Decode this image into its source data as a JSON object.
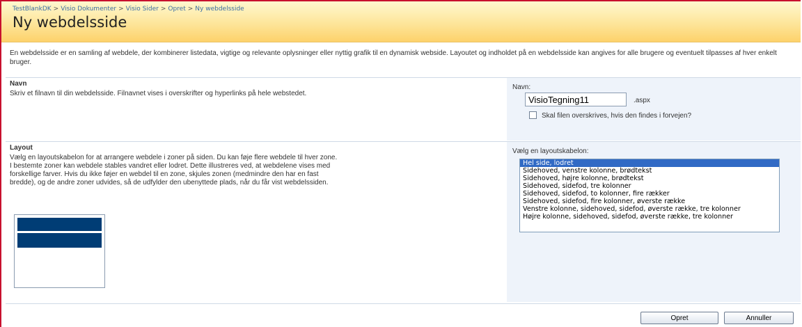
{
  "breadcrumb": [
    "TestBlankDK",
    "Visio Dokumenter",
    "Visio Sider",
    "Opret",
    "Ny webdelsside"
  ],
  "breadcrumb_separator": ">",
  "page_title": "Ny webdelsside",
  "intro": "En webdelsside er en samling af webdele, der kombinerer listedata, vigtige og relevante oplysninger eller nyttig grafik til en dynamisk webside. Layoutet og indholdet på en webdelsside kan angives for alle brugere og eventuelt tilpasses af hver enkelt bruger.",
  "name_section": {
    "title": "Navn",
    "description": "Skriv et filnavn til din webdelsside. Filnavnet vises i overskrifter og hyperlinks på hele webstedet.",
    "field_label": "Navn:",
    "value": "VisioTegning11",
    "extension": ".aspx",
    "overwrite_label": "Skal filen overskrives, hvis den findes i forvejen?",
    "overwrite_checked": false
  },
  "layout_section": {
    "title": "Layout",
    "description": "Vælg en layoutskabelon for at arrangere webdele i zoner på siden. Du kan føje flere webdele til hver zone. I bestemte zoner kan webdele stables vandret eller lodret. Dette illustreres ved, at webdelene vises med forskellige farver. Hvis du ikke føjer en webdel til en zone, skjules zonen (medmindre den har en fast bredde), og de andre zoner udvides, så de udfylder den ubenyttede plads, når du får vist webdelssiden.",
    "field_label": "Vælg en layoutskabelon:",
    "options": [
      "Hel side, lodret",
      "Sidehoved, venstre kolonne, brødtekst",
      "Sidehoved, højre kolonne, brødtekst",
      "Sidehoved, sidefod, tre kolonner",
      "Sidehoved, sidefod, to kolonner, fire rækker",
      "Sidehoved, sidefod, fire kolonner, øverste række",
      "Venstre kolonne, sidehoved, sidefod, øverste række, tre kolonner",
      "Højre kolonne, sidehoved, sidefod, øverste række, tre kolonner"
    ],
    "selected_index": 0
  },
  "buttons": {
    "create": "Opret",
    "cancel": "Annuller"
  },
  "colors": {
    "header_top": "#fff8cf",
    "header_bottom": "#fdd26b",
    "selection": "#316ac5",
    "preview_zone": "#003d75",
    "right_panel": "#eef3fa",
    "frame": "#c8102e"
  }
}
